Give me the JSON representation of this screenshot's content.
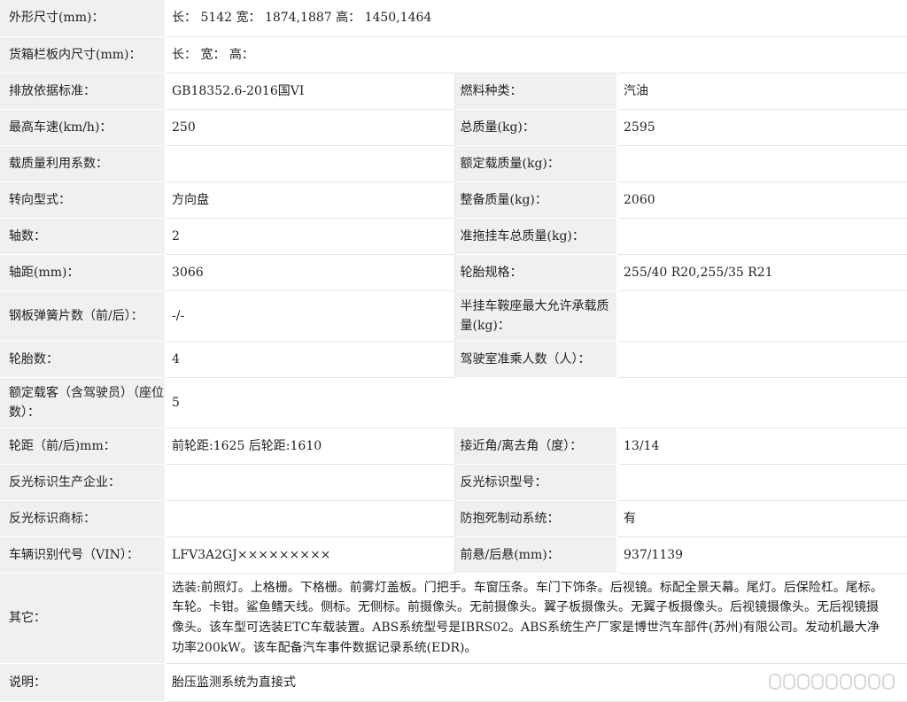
{
  "rows": [
    {
      "l1": "外形尺寸(mm)：",
      "v1": "长： 5142 宽： 1874,1887 高： 1450,1464"
    },
    {
      "l1": "货箱栏板内尺寸(mm)：",
      "v1": "长：  宽：  高："
    },
    {
      "l1": "排放依据标准：",
      "v1": "GB18352.6-2016国VI",
      "l2": "燃料种类：",
      "v2": "汽油"
    },
    {
      "l1": "最高车速(km/h)：",
      "v1": "250",
      "l2": "总质量(kg)：",
      "v2": "2595"
    },
    {
      "l1": "载质量利用系数：",
      "v1": "",
      "l2": "额定载质量(kg)：",
      "v2": ""
    },
    {
      "l1": "转向型式：",
      "v1": "方向盘",
      "l2": "整备质量(kg)：",
      "v2": "2060"
    },
    {
      "l1": "轴数：",
      "v1": "2",
      "l2": "准拖挂车总质量(kg)：",
      "v2": ""
    },
    {
      "l1": "轴距(mm)：",
      "v1": "3066",
      "l2": "轮胎规格：",
      "v2": "255/40 R20,255/35 R21"
    },
    {
      "l1": "钢板弹簧片数（前/后）：",
      "v1": "-/-",
      "l2": "半挂车鞍座最大允许承载质量(kg)：",
      "v2": ""
    },
    {
      "l1": "轮胎数：",
      "v1": "4",
      "l2": "驾驶室准乘人数（人）：",
      "v2": ""
    },
    {
      "l1": "额定载客（含驾驶员）（座位数）：",
      "v1": "5"
    },
    {
      "l1": "轮距（前/后)mm：",
      "v1": "前轮距:1625 后轮距:1610",
      "l2": "接近角/离去角（度）：",
      "v2": "13/14"
    },
    {
      "l1": "反光标识生产企业：",
      "v1": "",
      "l2": "反光标识型号：",
      "v2": ""
    },
    {
      "l1": "反光标识商标：",
      "v1": "",
      "l2": "防抱死制动系统：",
      "v2": "有"
    },
    {
      "l1": "车辆识别代号（VIN）：",
      "v1": "LFV3A2GJ×××××××××",
      "l2": "前悬/后悬(mm)：",
      "v2": "937/1139"
    },
    {
      "l1": "其它：",
      "v1": "选装:前照灯。上格栅。下格栅。前雾灯盖板。门把手。车窗压条。车门下饰条。后视镜。标配全景天幕。尾灯。后保险杠。尾标。车轮。卡钳。鲨鱼鳍天线。侧标。无侧标。前摄像头。无前摄像头。翼子板摄像头。无翼子板摄像头。后视镜摄像头。无后视镜摄像头。该车型可选装ETC车载装置。ABS系统型号是IBRS02。ABS系统生产厂家是博世汽车部件(苏州)有限公司。发动机最大净功率200kW。该车配备汽车事件数据记录系统(EDR)。"
    },
    {
      "l1": "说明：",
      "v1": "胎压监测系统为直接式"
    }
  ]
}
